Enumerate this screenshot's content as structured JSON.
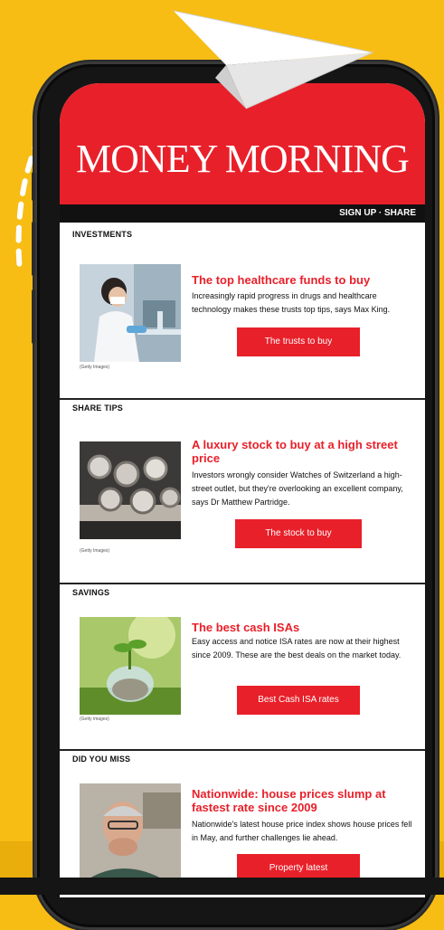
{
  "header": {
    "brand": "MONEY MORNING",
    "nav": "SIGN UP · SHARE"
  },
  "sections": [
    {
      "label": "INVESTMENTS",
      "title": "The top healthcare funds to buy",
      "description": "Increasingly rapid progress in drugs and healthcare technology makes these trusts top tips, says Max King.",
      "button": "The trusts to buy",
      "caption": "(Getty Images)"
    },
    {
      "label": "SHARE TIPS",
      "title": "A luxury stock to buy at a high street price",
      "description": "Investors wrongly consider Watches of Switzerland a high-street outlet, but they're overlooking an excellent company, says Dr Matthew Partridge.",
      "button": "The stock to buy",
      "caption": "(Getty Images)"
    },
    {
      "label": "SAVINGS",
      "title": "The best cash ISAs",
      "description": "Easy access and notice ISA rates are now at their highest since 2009. These are the best deals on the market today.",
      "button": "Best Cash ISA rates",
      "caption": "(Getty images)"
    },
    {
      "label": "DID YOU MISS",
      "title": "Nationwide: house prices slump at fastest rate since 2009",
      "description": "Nationwide's latest house price index shows house prices fell in May, and further challenges lie ahead.",
      "button": "Property latest"
    }
  ],
  "colors": {
    "background": "#f7bd14",
    "brand_red": "#e8202a",
    "phone": "#151515"
  },
  "icons": [
    "paper-plane-icon",
    "dashed-flight-path-icon"
  ]
}
